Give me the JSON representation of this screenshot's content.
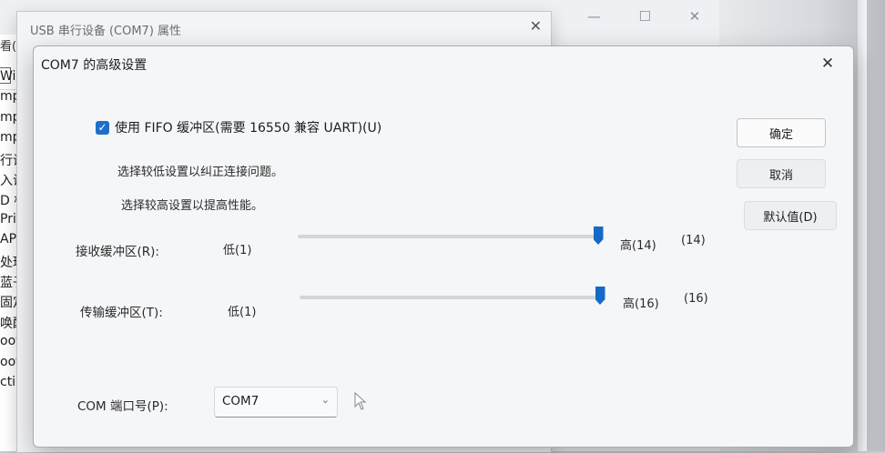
{
  "background_window": {
    "menu_fragment": "看(V",
    "list_fragments": [
      "Win",
      "mplia",
      "mplia",
      "mpo",
      "行设",
      "入设",
      "D 标",
      "Print",
      "APTO",
      "处理器",
      "蓝子",
      "固定功",
      "唤醒警",
      "ooth D",
      "ooth D",
      "ction V"
    ],
    "controls": {
      "minimize": "—",
      "maximize": "☐",
      "close": "✕"
    }
  },
  "properties_window": {
    "title": "USB 串行设备 (COM7) 属性",
    "close_glyph": "✕"
  },
  "dialog": {
    "title": "COM7 的高级设置",
    "close_glyph": "✕",
    "fifo": {
      "checked": true,
      "label": "使用 FIFO 缓冲区(需要 16550 兼容 UART)(U)"
    },
    "hint_low": "选择较低设置以纠正连接问题。",
    "hint_high": "选择较高设置以提高性能。",
    "receive": {
      "label": "接收缓冲区(R):",
      "low": "低(1)",
      "high": "高(14)",
      "value": "(14)",
      "level_fraction": 1.0
    },
    "transmit": {
      "label": "传输缓冲区(T):",
      "low": "低(1)",
      "high": "高(16)",
      "value": "(16)",
      "level_fraction": 1.0
    },
    "buttons": {
      "ok": "确定",
      "cancel": "取消",
      "defaults": "默认值(D)"
    },
    "com_port": {
      "label": "COM 端口号(P):",
      "value": "COM7"
    }
  },
  "colors": {
    "accent": "#1769c8",
    "checkbox": "#1f6fc9",
    "dialog_bg": "#f5f6f8"
  }
}
